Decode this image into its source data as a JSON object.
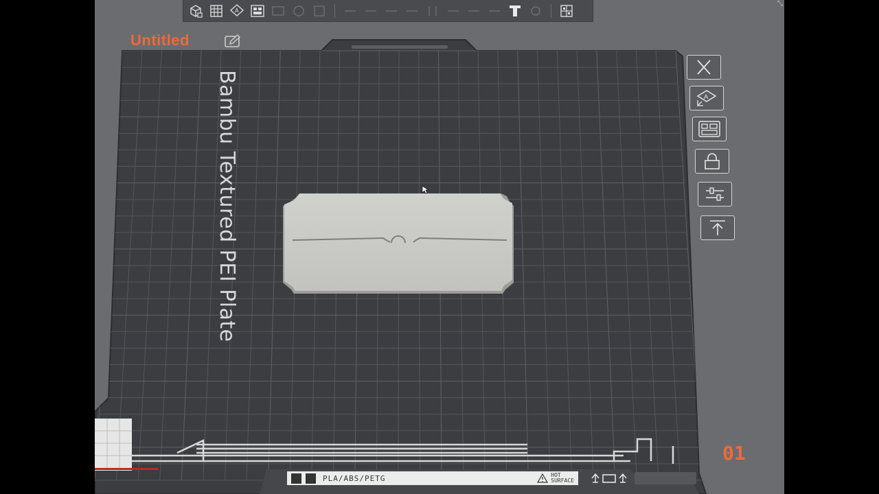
{
  "project": {
    "title": "Untitled"
  },
  "plate": {
    "label": "Bambu Textured PEI Plate",
    "number": "01",
    "filament_types": "PLA/ABS/PETG",
    "warning_line1": "HOT",
    "warning_line2": "SURFACE"
  },
  "toolbar": {
    "icons": [
      "add-cube-icon",
      "grid-icon",
      "auto-orient-icon",
      "arrange-icon",
      "text-icon",
      "assembly-icon"
    ]
  },
  "plate_tools": [
    "close-icon",
    "auto-orient-icon",
    "arrange-icon",
    "lock-icon",
    "settings-sliders-icon",
    "move-top-icon"
  ],
  "colors": {
    "accent": "#ef6a3a",
    "plate": "#3b3d41",
    "background": "#6b6c6f",
    "model": "#c9cac5"
  }
}
